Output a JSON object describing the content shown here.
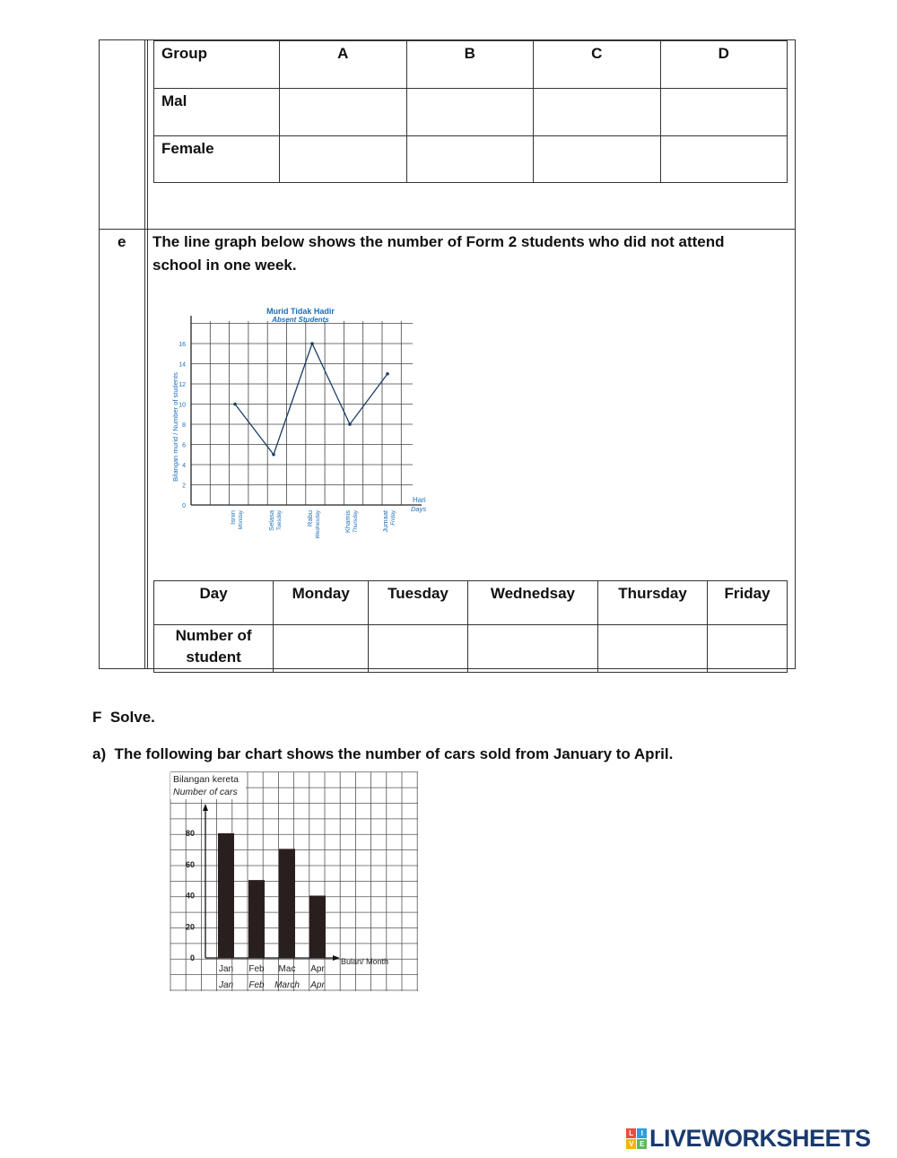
{
  "group_table": {
    "headers": [
      "Group",
      "A",
      "B",
      "C",
      "D"
    ],
    "rows": [
      [
        "Mal",
        "",
        "",
        "",
        ""
      ],
      [
        "Female",
        "",
        "",
        "",
        ""
      ]
    ]
  },
  "question_e": {
    "label": "e",
    "text_line1": "The line graph below shows the number of Form 2 students who did not attend",
    "text_line2": "school in one week."
  },
  "day_table": {
    "headers": [
      "Day",
      "Monday",
      "Tuesday",
      "Wednedsay",
      "Thursday",
      "Friday"
    ],
    "row_label_line1": "Number of",
    "row_label_line2": "student",
    "cells": [
      "",
      "",
      "",
      "",
      ""
    ]
  },
  "section_f": {
    "heading": "F  Solve.",
    "question_a": "a)  The following bar chart shows the number of cars sold from January to April."
  },
  "logo": {
    "text": "LIVEWORKSHEETS",
    "letters": [
      "L",
      "I",
      "V",
      "E"
    ],
    "colors": [
      "#e94e3c",
      "#2a9fd8",
      "#f4b400",
      "#5cb85c"
    ]
  },
  "chart_data": [
    {
      "type": "line",
      "title": "Murid Tidak Hadir",
      "subtitle": "Absent Students",
      "ylabel": "Bilangan murid / Number of students",
      "xlabel_line1": "Hari",
      "xlabel_line2": "Days",
      "categories": [
        "Isnin",
        "Selasa",
        "Rabu",
        "Khamis",
        "Jumaat"
      ],
      "categories_en": [
        "Monday",
        "Tuesday",
        "Wednesday",
        "Thursday",
        "Friday"
      ],
      "values": [
        10,
        5,
        16,
        8,
        13
      ],
      "yticks": [
        0,
        2,
        4,
        6,
        8,
        10,
        12,
        14,
        16
      ],
      "ylim": [
        0,
        16
      ],
      "grid": true,
      "color": "#1d6fb8"
    },
    {
      "type": "bar",
      "ylabel_line1": "Bilangan kereta",
      "ylabel_line2": "Number of cars",
      "xlabel": "Bulan/ Month",
      "categories": [
        "Jan",
        "Feb",
        "Mac",
        "Apr"
      ],
      "categories_en": [
        "Jan",
        "Feb",
        "March",
        "Apr"
      ],
      "values": [
        80,
        50,
        70,
        40
      ],
      "yticks": [
        0,
        20,
        40,
        60,
        80
      ],
      "ylim": [
        0,
        80
      ],
      "grid": true,
      "color": "#2a1f1f"
    }
  ]
}
